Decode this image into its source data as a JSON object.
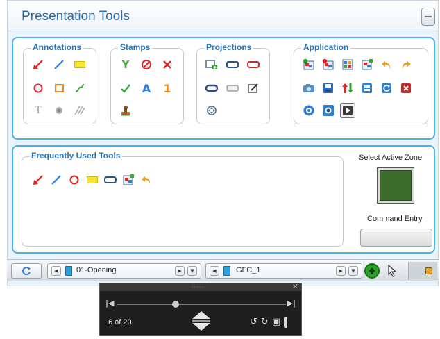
{
  "window": {
    "title": "Presentation Tools",
    "collapse_icon": "collapse-icon"
  },
  "groups": {
    "annotations": {
      "label": "Annotations",
      "icons": [
        "red-arrow-icon",
        "blue-line-icon",
        "yellow-highlight-icon",
        "red-circle-icon",
        "orange-rectangle-icon",
        "green-freehand-icon",
        "text-tool-icon",
        "blur-dot-icon",
        "hatch-icon"
      ]
    },
    "stamps": {
      "label": "Stamps",
      "icons": [
        "checkmark-y-icon",
        "no-symbol-icon",
        "x-mark-icon",
        "green-check-icon",
        "letter-a-icon",
        "number-one-icon",
        "stamp-icon"
      ]
    },
    "projections": {
      "label": "Projections",
      "icons": [
        "add-projection-icon",
        "blue-callout-icon",
        "red-callout-icon",
        "oval-callout-icon",
        "gray-callout-icon",
        "edit-callout-icon",
        "zoom-pan-icon"
      ]
    },
    "application": {
      "label": "Application",
      "icons": [
        "app-green-icon",
        "app-red-icon",
        "app-grid-icon",
        "app-select-icon",
        "undo-icon",
        "redo-icon",
        "camera-icon",
        "save-icon",
        "sort-icon",
        "blue-tool-icon",
        "refresh-icon",
        "close-red-icon",
        "zoom-in-icon",
        "stop-icon",
        "play-icon"
      ]
    }
  },
  "frequent": {
    "label": "Frequently Used Tools",
    "icons": [
      "red-arrow-icon",
      "blue-line-icon",
      "red-circle-icon",
      "yellow-highlight-icon",
      "blue-callout-icon",
      "app-select-icon",
      "undo-icon"
    ]
  },
  "stamps_text": {
    "y": "Y",
    "a": "A",
    "one": "1"
  },
  "zone": {
    "label": "Select Active Zone",
    "color": "#3d6b2b",
    "command_label": "Command Entry"
  },
  "toolbar": {
    "doc1": "01-Opening",
    "doc2": "GFC_1"
  },
  "player": {
    "position": "6 of 20",
    "progress_fraction": 0.35
  }
}
